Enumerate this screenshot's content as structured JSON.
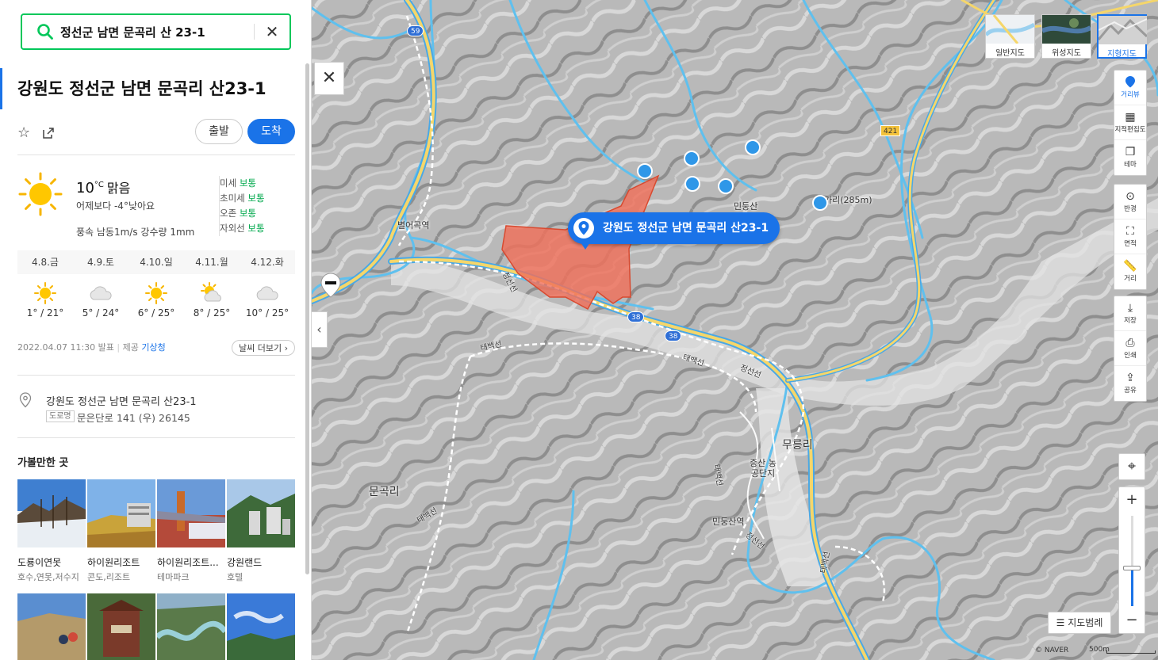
{
  "search": {
    "value": "정선군 남면 문곡리 산 23-1"
  },
  "place": {
    "title": "강원도 정선군 남면 문곡리 산23-1",
    "depart_label": "출발",
    "arrive_label": "도착"
  },
  "weather": {
    "temp": "10",
    "unit": "°C",
    "condition": "맑음",
    "compare": "어제보다 -4°낮아요",
    "extra": "풍속 남동1m/s  강수량 1mm",
    "air": [
      {
        "label": "미세",
        "value": "보통"
      },
      {
        "label": "초미세",
        "value": "보통"
      },
      {
        "label": "오존",
        "value": "보통"
      },
      {
        "label": "자외선",
        "value": "보통"
      }
    ],
    "forecast": [
      {
        "date": "4.8.금",
        "icon": "sun-icon",
        "temps": "1° / 21°"
      },
      {
        "date": "4.9.토",
        "icon": "cloud-icon",
        "temps": "5° / 24°"
      },
      {
        "date": "4.10.일",
        "icon": "sun-icon",
        "temps": "6° / 25°"
      },
      {
        "date": "4.11.월",
        "icon": "partly-cloudy-icon",
        "temps": "8° / 25°"
      },
      {
        "date": "4.12.화",
        "icon": "cloud-icon",
        "temps": "10° / 25°"
      }
    ],
    "issued": "2022.04.07 11:30 발표",
    "provider_prefix": "제공",
    "provider": "기상청",
    "more_label": "날씨 더보기"
  },
  "address": {
    "jibun": "강원도 정선군 남면 문곡리 산23-1",
    "road_tag": "도로명",
    "road": "문은단로 141 (우) 26145"
  },
  "recommend": {
    "title": "가볼만한 곳",
    "items": [
      {
        "name": "도룡이연못",
        "category": "호수,연못,저수지"
      },
      {
        "name": "하이원리조트",
        "category": "콘도,리조트"
      },
      {
        "name": "하이원리조트...",
        "category": "테마파크"
      },
      {
        "name": "강원랜드",
        "category": "호텔"
      }
    ]
  },
  "map": {
    "marker_label": "강원도 정선군 남면 문곡리 산23-1",
    "parcel_color": "#f0705a",
    "labels": {
      "station1": "별어곡역",
      "station2": "민둥산역",
      "village1": "문곡리",
      "village2": "무릉리",
      "complex": "증산 농공단지",
      "mountain1": "민둥산",
      "mountain2": "가리",
      "mountain2_height": "285m",
      "rail_jeongseon": "정선선",
      "rail_taebaek": "태백선"
    },
    "routes": [
      "59",
      "38",
      "421"
    ],
    "map_types": [
      {
        "label": "일반지도",
        "selected": false
      },
      {
        "label": "위성지도",
        "selected": false
      },
      {
        "label": "지형지도",
        "selected": true
      }
    ],
    "tools_group1": [
      {
        "label": "거리뷰",
        "icon": "street-view-icon",
        "active": true
      },
      {
        "label": "지적편집도",
        "icon": "cadastral-icon",
        "active": false
      },
      {
        "label": "테마",
        "icon": "theme-icon",
        "active": false
      }
    ],
    "tools_group2": [
      {
        "label": "반경",
        "icon": "radius-icon"
      },
      {
        "label": "면적",
        "icon": "area-icon"
      },
      {
        "label": "거리",
        "icon": "ruler-icon"
      }
    ],
    "tools_group3": [
      {
        "label": "저장",
        "icon": "download-icon"
      },
      {
        "label": "인쇄",
        "icon": "print-icon"
      },
      {
        "label": "공유",
        "icon": "share-icon"
      }
    ],
    "zoom_level_fraction": 0.42,
    "legend_label": "지도범례",
    "copyright": "© NAVER",
    "scale": "500m"
  }
}
